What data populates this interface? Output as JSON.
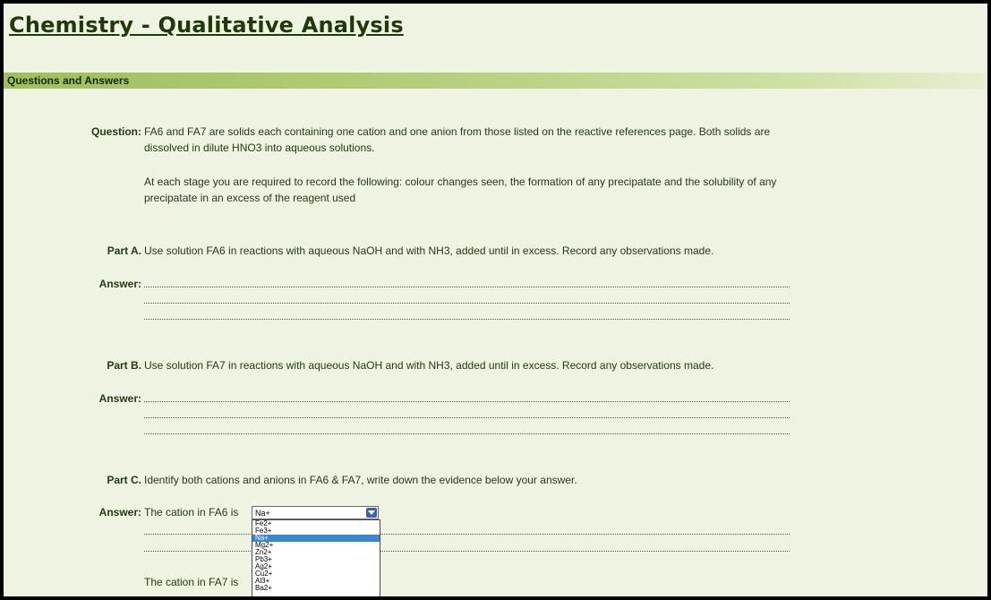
{
  "page": {
    "title": "Chemistry - Qualitative Analysis"
  },
  "section": {
    "title": "Questions and Answers"
  },
  "question": {
    "label": "Question:",
    "line1": "FA6 and FA7 are solids each containing one cation and one anion from those listed on the reactive references page. Both solids are",
    "line2": "dissolved in dilute HNO3 into aqueous solutions.",
    "line3": "At each stage you are required to record the following: colour changes seen, the formation of any precipatate and the solubility of any",
    "line4": "precipatate in an excess of the reagent used"
  },
  "part_a": {
    "label": "Part A.",
    "text": "Use solution FA6 in reactions with aqueous NaOH and with NH3, added until in excess. Record any observations made.",
    "answer_label": "Answer:"
  },
  "part_b": {
    "label": "Part B.",
    "text": "Use solution FA7 in reactions with aqueous NaOH and with NH3, added until in excess. Record any observations made.",
    "answer_label": "Answer:"
  },
  "part_c": {
    "label": "Part C.",
    "text": "Identify both cations and anions in FA6 & FA7, write down the evidence below your answer.",
    "answer_label": "Answer:",
    "fa6_cation_prompt": "The cation in FA6 is",
    "fa7_cation_prompt": "The cation in FA7 is",
    "fa6_cation_selected": "Na+",
    "cation_options": [
      "Fe2+",
      "Fe3+",
      "Na+",
      "Mg2+",
      "Zn2+",
      "Pb3+",
      "Ag2+",
      "Cu2+",
      "Al3+",
      "Ba2+"
    ],
    "highlighted_option": "Na+"
  },
  "colors": {
    "page_bg": "#eef4e1",
    "section_bar": "#9fbf5d",
    "title_text": "#1f3a08",
    "dropdown_highlight": "#3a86d6"
  }
}
